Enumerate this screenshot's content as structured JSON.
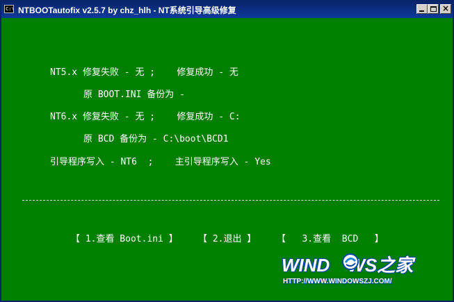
{
  "window": {
    "title": "NTBOOTautofix v2.5.7 by chz_hlh - NT系统引导高级修复",
    "icon": "console-icon",
    "controls": {
      "minimize": "minimize-icon",
      "maximize": "maximize-icon",
      "close": "close-icon"
    }
  },
  "content": {
    "nt5_line": "NT5.x 修复失败 - 无 ;    修复成功 - 无",
    "nt5_backup": "原 BOOT.INI 备份为 -",
    "nt6_line": "NT6.x 修复失败 - 无 ;    修复成功 - C:",
    "nt6_backup": "原 BCD 备份为 - C:\\boot\\BCD1",
    "boot_write": "引导程序写入 - NT6  ;    主引导程序写入 - Yes"
  },
  "buttons": {
    "view_bootini": "【 1.查看 Boot.ini 】",
    "exit": "【 2.退出 】",
    "view_bcd": "【   3.查看  BCD   】"
  },
  "watermark": {
    "logo_text_left": "WIND",
    "logo_text_right": "WS之家",
    "url": "HTTP://WWW.WINDOWSZJ.COM/"
  },
  "colors": {
    "background": "#007f00",
    "text": "#ffffff",
    "titlebar": "#0a246a"
  }
}
